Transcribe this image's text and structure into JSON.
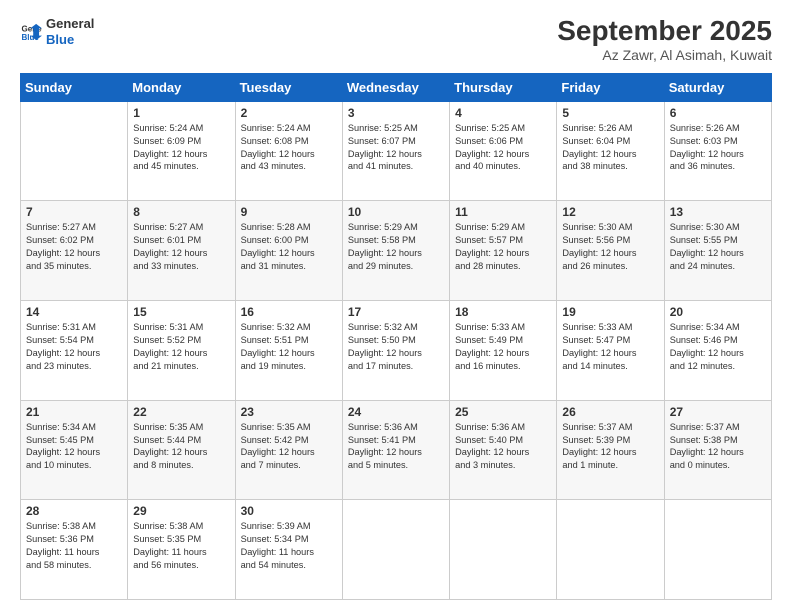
{
  "logo": {
    "line1": "General",
    "line2": "Blue"
  },
  "title": "September 2025",
  "subtitle": "Az Zawr, Al Asimah, Kuwait",
  "headers": [
    "Sunday",
    "Monday",
    "Tuesday",
    "Wednesday",
    "Thursday",
    "Friday",
    "Saturday"
  ],
  "weeks": [
    [
      {
        "day": "",
        "lines": []
      },
      {
        "day": "1",
        "lines": [
          "Sunrise: 5:24 AM",
          "Sunset: 6:09 PM",
          "Daylight: 12 hours",
          "and 45 minutes."
        ]
      },
      {
        "day": "2",
        "lines": [
          "Sunrise: 5:24 AM",
          "Sunset: 6:08 PM",
          "Daylight: 12 hours",
          "and 43 minutes."
        ]
      },
      {
        "day": "3",
        "lines": [
          "Sunrise: 5:25 AM",
          "Sunset: 6:07 PM",
          "Daylight: 12 hours",
          "and 41 minutes."
        ]
      },
      {
        "day": "4",
        "lines": [
          "Sunrise: 5:25 AM",
          "Sunset: 6:06 PM",
          "Daylight: 12 hours",
          "and 40 minutes."
        ]
      },
      {
        "day": "5",
        "lines": [
          "Sunrise: 5:26 AM",
          "Sunset: 6:04 PM",
          "Daylight: 12 hours",
          "and 38 minutes."
        ]
      },
      {
        "day": "6",
        "lines": [
          "Sunrise: 5:26 AM",
          "Sunset: 6:03 PM",
          "Daylight: 12 hours",
          "and 36 minutes."
        ]
      }
    ],
    [
      {
        "day": "7",
        "lines": [
          "Sunrise: 5:27 AM",
          "Sunset: 6:02 PM",
          "Daylight: 12 hours",
          "and 35 minutes."
        ]
      },
      {
        "day": "8",
        "lines": [
          "Sunrise: 5:27 AM",
          "Sunset: 6:01 PM",
          "Daylight: 12 hours",
          "and 33 minutes."
        ]
      },
      {
        "day": "9",
        "lines": [
          "Sunrise: 5:28 AM",
          "Sunset: 6:00 PM",
          "Daylight: 12 hours",
          "and 31 minutes."
        ]
      },
      {
        "day": "10",
        "lines": [
          "Sunrise: 5:29 AM",
          "Sunset: 5:58 PM",
          "Daylight: 12 hours",
          "and 29 minutes."
        ]
      },
      {
        "day": "11",
        "lines": [
          "Sunrise: 5:29 AM",
          "Sunset: 5:57 PM",
          "Daylight: 12 hours",
          "and 28 minutes."
        ]
      },
      {
        "day": "12",
        "lines": [
          "Sunrise: 5:30 AM",
          "Sunset: 5:56 PM",
          "Daylight: 12 hours",
          "and 26 minutes."
        ]
      },
      {
        "day": "13",
        "lines": [
          "Sunrise: 5:30 AM",
          "Sunset: 5:55 PM",
          "Daylight: 12 hours",
          "and 24 minutes."
        ]
      }
    ],
    [
      {
        "day": "14",
        "lines": [
          "Sunrise: 5:31 AM",
          "Sunset: 5:54 PM",
          "Daylight: 12 hours",
          "and 23 minutes."
        ]
      },
      {
        "day": "15",
        "lines": [
          "Sunrise: 5:31 AM",
          "Sunset: 5:52 PM",
          "Daylight: 12 hours",
          "and 21 minutes."
        ]
      },
      {
        "day": "16",
        "lines": [
          "Sunrise: 5:32 AM",
          "Sunset: 5:51 PM",
          "Daylight: 12 hours",
          "and 19 minutes."
        ]
      },
      {
        "day": "17",
        "lines": [
          "Sunrise: 5:32 AM",
          "Sunset: 5:50 PM",
          "Daylight: 12 hours",
          "and 17 minutes."
        ]
      },
      {
        "day": "18",
        "lines": [
          "Sunrise: 5:33 AM",
          "Sunset: 5:49 PM",
          "Daylight: 12 hours",
          "and 16 minutes."
        ]
      },
      {
        "day": "19",
        "lines": [
          "Sunrise: 5:33 AM",
          "Sunset: 5:47 PM",
          "Daylight: 12 hours",
          "and 14 minutes."
        ]
      },
      {
        "day": "20",
        "lines": [
          "Sunrise: 5:34 AM",
          "Sunset: 5:46 PM",
          "Daylight: 12 hours",
          "and 12 minutes."
        ]
      }
    ],
    [
      {
        "day": "21",
        "lines": [
          "Sunrise: 5:34 AM",
          "Sunset: 5:45 PM",
          "Daylight: 12 hours",
          "and 10 minutes."
        ]
      },
      {
        "day": "22",
        "lines": [
          "Sunrise: 5:35 AM",
          "Sunset: 5:44 PM",
          "Daylight: 12 hours",
          "and 8 minutes."
        ]
      },
      {
        "day": "23",
        "lines": [
          "Sunrise: 5:35 AM",
          "Sunset: 5:42 PM",
          "Daylight: 12 hours",
          "and 7 minutes."
        ]
      },
      {
        "day": "24",
        "lines": [
          "Sunrise: 5:36 AM",
          "Sunset: 5:41 PM",
          "Daylight: 12 hours",
          "and 5 minutes."
        ]
      },
      {
        "day": "25",
        "lines": [
          "Sunrise: 5:36 AM",
          "Sunset: 5:40 PM",
          "Daylight: 12 hours",
          "and 3 minutes."
        ]
      },
      {
        "day": "26",
        "lines": [
          "Sunrise: 5:37 AM",
          "Sunset: 5:39 PM",
          "Daylight: 12 hours",
          "and 1 minute."
        ]
      },
      {
        "day": "27",
        "lines": [
          "Sunrise: 5:37 AM",
          "Sunset: 5:38 PM",
          "Daylight: 12 hours",
          "and 0 minutes."
        ]
      }
    ],
    [
      {
        "day": "28",
        "lines": [
          "Sunrise: 5:38 AM",
          "Sunset: 5:36 PM",
          "Daylight: 11 hours",
          "and 58 minutes."
        ]
      },
      {
        "day": "29",
        "lines": [
          "Sunrise: 5:38 AM",
          "Sunset: 5:35 PM",
          "Daylight: 11 hours",
          "and 56 minutes."
        ]
      },
      {
        "day": "30",
        "lines": [
          "Sunrise: 5:39 AM",
          "Sunset: 5:34 PM",
          "Daylight: 11 hours",
          "and 54 minutes."
        ]
      },
      {
        "day": "",
        "lines": []
      },
      {
        "day": "",
        "lines": []
      },
      {
        "day": "",
        "lines": []
      },
      {
        "day": "",
        "lines": []
      }
    ]
  ]
}
